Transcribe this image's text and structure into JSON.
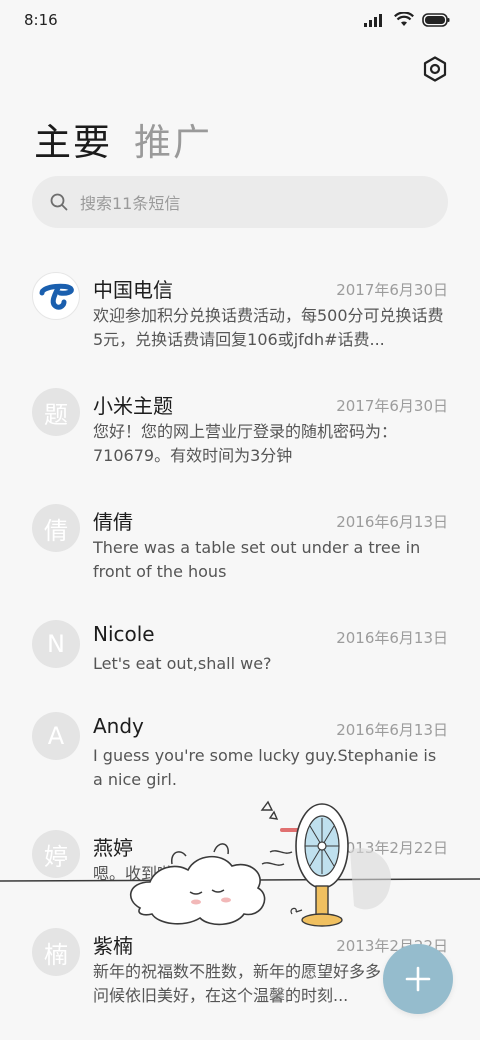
{
  "status": {
    "time": "8:16"
  },
  "tabs": [
    {
      "label": "主要",
      "active": true
    },
    {
      "label": "推广",
      "active": false
    }
  ],
  "search": {
    "placeholder": "搜索11条短信"
  },
  "messages": [
    {
      "name": "中国电信",
      "avatar": "",
      "avatar_icon": "china-telecom-logo",
      "date": "2017年6月30日",
      "preview": "欢迎参加积分兑换话费活动，每500分可兑换话费5元，兑换话费请回复106或jfdh#话费..."
    },
    {
      "name": "小米主题",
      "avatar": "题",
      "date": "2017年6月30日",
      "preview": "您好！您的网上营业厅登录的随机密码为：710679。有效时间为3分钟"
    },
    {
      "name": "倩倩",
      "avatar": "倩",
      "date": "2016年6月13日",
      "preview": "There was a table set out under a tree in front of the hous"
    },
    {
      "name": "Nicole",
      "avatar": "N",
      "date": "2016年6月13日",
      "preview": "Let's eat out,shall we?"
    },
    {
      "name": "Andy",
      "avatar": "A",
      "date": "2016年6月13日",
      "preview": "I guess you're some lucky guy.Stephanie is a nice girl."
    },
    {
      "name": "燕婷",
      "avatar": "婷",
      "date": "2013年2月22日",
      "preview": "嗯。收到啦，同乐同乐"
    },
    {
      "name": "紫楠",
      "avatar": "楠",
      "date": "2013年2月22日",
      "preview": "新年的祝福数不胜数，新年的愿望好多多，新年的问候依旧美好，在这个温馨的时刻..."
    }
  ],
  "colors": {
    "fab": "#95bccd",
    "avatar_bg": "#e4e4e4",
    "telecom_blue": "#1a5fae"
  },
  "icons": {
    "settings": "settings-hex-icon",
    "search": "search-icon",
    "fab": "plus-icon"
  }
}
